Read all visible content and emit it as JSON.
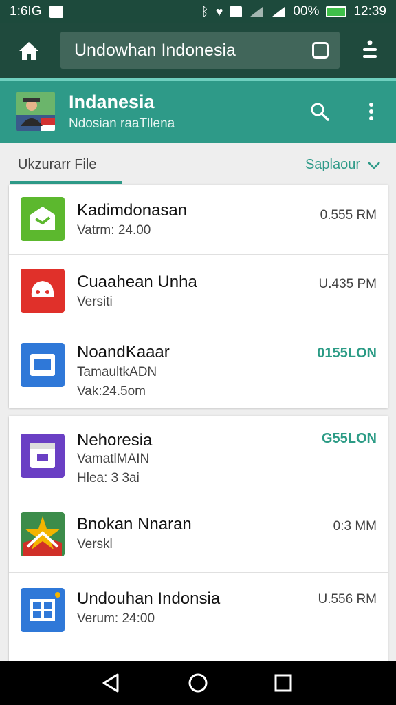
{
  "status_bar": {
    "left_text": "1:6IG",
    "battery": "00%",
    "time": "12:39"
  },
  "toolbar": {
    "search_value": "Undowhan Indonesia",
    "icons": [
      "home-icon",
      "tabs-icon",
      "filter-icon"
    ]
  },
  "profile": {
    "title": "Indanesia",
    "subtitle": "Ndosian raaTllena"
  },
  "tabs": {
    "file_label": "Ukzurarr File",
    "sort_label": "Saplaour"
  },
  "apps_group1": [
    {
      "name": "Kadimdonasan",
      "line1": "Vatrm: 24.00",
      "line2": "",
      "size": "0.555 RM",
      "icon_color": "#5cb82e"
    },
    {
      "name": "Cuaahean Unha",
      "line1": "Versiti",
      "line2": "",
      "size": "U.435 PM",
      "icon_color": "#e0302a"
    },
    {
      "name": "NoandKaaar",
      "line1": "TamaultkADN",
      "line2": "Vak:24.5om",
      "size": "0155LON",
      "icon_color": "#2f78d8"
    }
  ],
  "apps_group2": [
    {
      "name": "Nehoresia",
      "line1": "VamatlMAIN",
      "line2": "Hlea: 3 3ai",
      "size": "G55LON",
      "icon_color": "#6a3fc4"
    },
    {
      "name": "Bnokan Nnaran",
      "line1": "Verskl",
      "line2": "",
      "size": "0:3 MM",
      "icon_color": "#c8352c"
    },
    {
      "name": "Undouhan Indonsia",
      "line1": "Verum: 24:00",
      "line2": "",
      "size": "U.556 RM",
      "icon_color": "#2f78d8"
    }
  ],
  "colors": {
    "header_dark": "#1f4a3d",
    "accent": "#2e9a88"
  }
}
